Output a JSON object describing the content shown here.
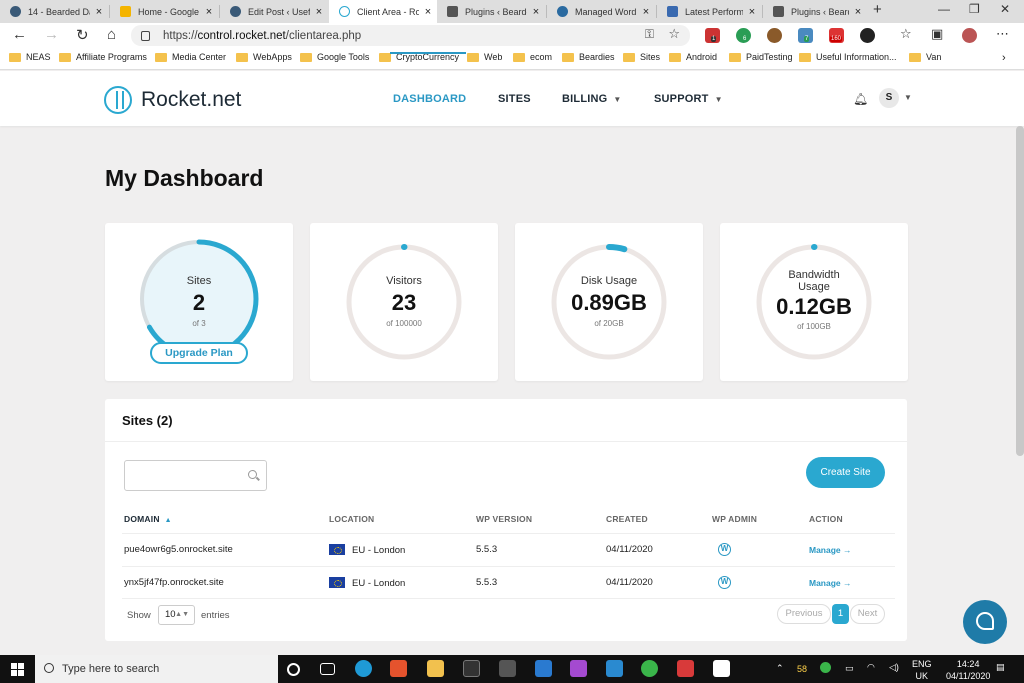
{
  "browser": {
    "tabs": [
      {
        "title": "14 - Bearded Da",
        "icon": "wordpress-icon",
        "color": "#3a5a78",
        "active": false
      },
      {
        "title": "Home - Google",
        "icon": "google-drive-icon",
        "color": "#f4b400",
        "active": false
      },
      {
        "title": "Edit Post ‹ Usefu",
        "icon": "wordpress-icon",
        "color": "#3a5a78",
        "active": false
      },
      {
        "title": "Client Area - Ro",
        "icon": "rocket-icon",
        "color": "#2aa8d0",
        "active": true
      },
      {
        "title": "Plugins ‹ Bearde",
        "icon": "site-icon",
        "color": "#555555",
        "active": false
      },
      {
        "title": "Managed Word",
        "icon": "wordpress-icon",
        "color": "#2a6aa0",
        "active": false
      },
      {
        "title": "Latest Performa",
        "icon": "page-icon",
        "color": "#3a6ab0",
        "active": false
      },
      {
        "title": "Plugins ‹ Bearde",
        "icon": "site-icon",
        "color": "#555555",
        "active": false
      }
    ],
    "url_scheme": "https://",
    "url_host": "control.rocket.net",
    "url_path": "/clientarea.php",
    "bookmarks": [
      "NEAS",
      "Affiliate Programs",
      "Media Center",
      "WebApps",
      "Google Tools",
      "CryptoCurrency",
      "Web",
      "ecom",
      "Beardies",
      "Sites",
      "Android",
      "PaidTesting",
      "Useful Information...",
      "Van"
    ],
    "extension_badges": [
      "1",
      "6",
      "",
      "7",
      "160",
      ""
    ]
  },
  "header": {
    "logo_brand": "Rocket",
    "logo_suffix": ".net",
    "nav": [
      {
        "label": "DASHBOARD",
        "active": true,
        "dropdown": false
      },
      {
        "label": "SITES",
        "active": false,
        "dropdown": false
      },
      {
        "label": "BILLING",
        "active": false,
        "dropdown": true
      },
      {
        "label": "SUPPORT",
        "active": false,
        "dropdown": true
      }
    ],
    "user_initial": "S"
  },
  "page": {
    "title": "My Dashboard"
  },
  "stats": [
    {
      "label": "Sites",
      "value": "2",
      "sub": "of 3",
      "fraction": 0.667,
      "button": "Upgrade Plan"
    },
    {
      "label": "Visitors",
      "value": "23",
      "sub": "of 100000",
      "fraction": 0.0002
    },
    {
      "label": "Disk Usage",
      "value": "0.89GB",
      "sub": "of 20GB",
      "fraction": 0.045
    },
    {
      "label": "Bandwidth Usage",
      "value": "0.12GB",
      "sub": "of 100GB",
      "fraction": 0.0012
    }
  ],
  "sites_panel": {
    "title": "Sites (2)",
    "search_placeholder": "",
    "create_label": "Create Site",
    "columns": [
      "DOMAIN",
      "LOCATION",
      "WP VERSION",
      "CREATED",
      "WP ADMIN",
      "ACTION"
    ],
    "rows": [
      {
        "domain": "pue4owr6g5.onrocket.site",
        "location": "EU - London",
        "wp_version": "5.5.3",
        "created": "04/11/2020",
        "action": "Manage →"
      },
      {
        "domain": "ynx5jf47fp.onrocket.site",
        "location": "EU - London",
        "wp_version": "5.5.3",
        "created": "04/11/2020",
        "action": "Manage →"
      }
    ],
    "show_label": "Show",
    "entries_value": "10",
    "entries_label": "entries",
    "pagination": {
      "previous": "Previous",
      "current": "1",
      "next": "Next"
    }
  },
  "taskbar": {
    "search_placeholder": "Type here to search",
    "tray_number": "58",
    "lang": "ENG",
    "region": "UK",
    "time": "14:24",
    "date": "04/11/2020"
  },
  "colors": {
    "accent": "#2aa8d0",
    "ring_track": "#ece6e4",
    "background": "#f0efef"
  }
}
